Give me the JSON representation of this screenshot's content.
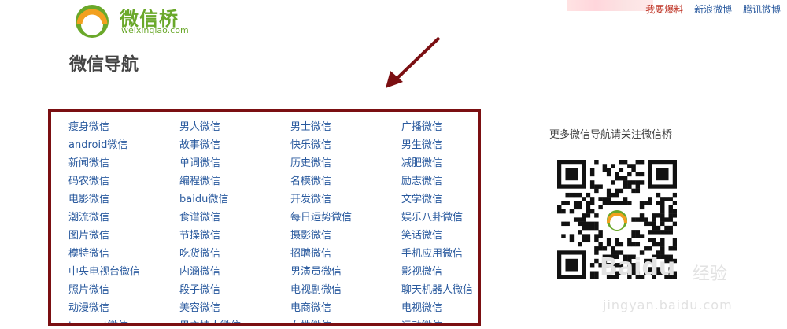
{
  "brand": {
    "name": "微信桥",
    "domain": "weixinqiao.com",
    "green": "#6aa82a",
    "orange": "#f2a01f"
  },
  "topnav": {
    "items": [
      {
        "label": "我要爆料",
        "color": "#c0392b"
      },
      {
        "label": "新浪微博",
        "color": "#2a5a9e"
      },
      {
        "label": "腾讯微博",
        "color": "#2a5a9e"
      }
    ]
  },
  "page": {
    "title": "微信导航"
  },
  "nav": {
    "border_color": "#7b0f12",
    "link_color": "#2a5a9e",
    "rows": [
      [
        "瘦身微信",
        "男人微信",
        "男士微信",
        "广播微信"
      ],
      [
        "android微信",
        "故事微信",
        "快乐微信",
        "男生微信"
      ],
      [
        "新闻微信",
        "单词微信",
        "历史微信",
        "减肥微信"
      ],
      [
        "码农微信",
        "编程微信",
        "名模微信",
        "励志微信"
      ],
      [
        "电影微信",
        "baidu微信",
        "开发微信",
        "文学微信"
      ],
      [
        "潮流微信",
        "食谱微信",
        "每日运势微信",
        "娱乐八卦微信"
      ],
      [
        "图片微信",
        "节操微信",
        "摄影微信",
        "笑话微信"
      ],
      [
        "模特微信",
        "吃货微信",
        "招聘微信",
        "手机应用微信"
      ],
      [
        "中央电视台微信",
        "内涵微信",
        "男演员微信",
        "影视微信"
      ],
      [
        "照片微信",
        "段子微信",
        "电视剧微信",
        "聊天机器人微信"
      ],
      [
        "动漫微信",
        "美容微信",
        "电商微信",
        "电视微信"
      ],
      [
        "tencent微信",
        "男主持人微信",
        "女性微信",
        "运动微信"
      ]
    ]
  },
  "sidebar": {
    "note": "更多微信导航请关注微信桥"
  },
  "watermark": {
    "baidu": "Baidu",
    "jingyan": "经验",
    "url": "jingyan.baidu.com"
  }
}
